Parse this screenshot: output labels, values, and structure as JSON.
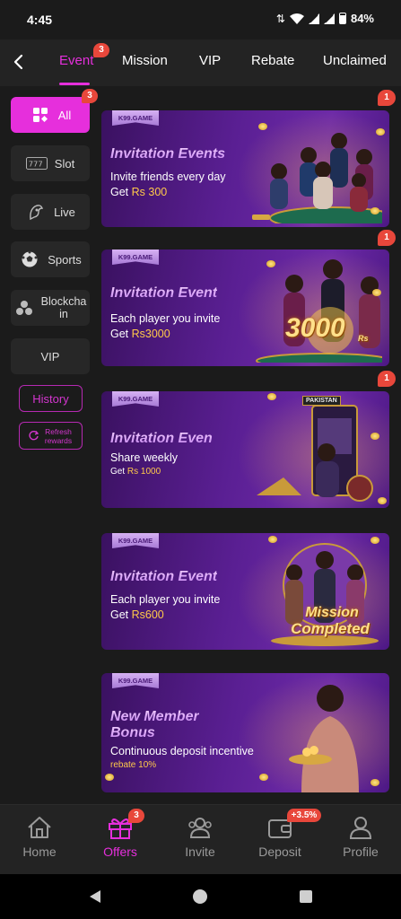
{
  "status": {
    "time": "4:45",
    "battery": "84%"
  },
  "tabs": [
    {
      "label": "Event",
      "badge": "3",
      "active": true
    },
    {
      "label": "Mission"
    },
    {
      "label": "VIP"
    },
    {
      "label": "Rebate"
    },
    {
      "label": "Unclaimed"
    }
  ],
  "sidebar": {
    "items": [
      {
        "label": "All",
        "icon": "grid-icon",
        "badge": "3",
        "active": true
      },
      {
        "label": "Slot",
        "icon": "slot-icon"
      },
      {
        "label": "Live",
        "icon": "live-icon"
      },
      {
        "label": "Sports",
        "icon": "soccer-ball-icon"
      },
      {
        "label": "Blockchain",
        "icon": "blockchain-icon"
      },
      {
        "label": "VIP"
      }
    ],
    "history_label": "History",
    "refresh_label": "Refresh rewards"
  },
  "banners": [
    {
      "brand": "K99.GAME",
      "title": "Invitation Events",
      "subtitle": "Invite friends every day",
      "get_prefix": "Get ",
      "amount": "Rs 300",
      "badge": "1"
    },
    {
      "brand": "K99.GAME",
      "title": "Invitation Event",
      "subtitle": "Each player you invite",
      "get_prefix": "Get ",
      "amount": "Rs3000",
      "badge": "1",
      "art_text": "3000",
      "art_unit": "Rs"
    },
    {
      "brand": "K99.GAME",
      "title": "Invitation Even",
      "subtitle": "Share weekly",
      "get_prefix": "Get ",
      "amount": "Rs 1000",
      "badge": "1",
      "art_text": "PAKISTAN"
    },
    {
      "brand": "K99.GAME",
      "title": "Invitation Event",
      "subtitle": "Each player you invite",
      "get_prefix": "Get ",
      "amount": "Rs600",
      "art_text": "Mission",
      "art_text2": "Completed"
    },
    {
      "brand": "K99.GAME",
      "title": "New Member",
      "title2": "Bonus",
      "subtitle": "Continuous deposit incentive",
      "get_prefix": "",
      "amount": "rebate 10%"
    }
  ],
  "bottom_nav": [
    {
      "label": "Home",
      "icon": "home-icon"
    },
    {
      "label": "Offers",
      "icon": "gift-icon",
      "badge": "3",
      "active": true
    },
    {
      "label": "Invite",
      "icon": "invite-icon"
    },
    {
      "label": "Deposit",
      "icon": "wallet-icon",
      "badge": "+3.5%"
    },
    {
      "label": "Profile",
      "icon": "profile-icon"
    }
  ],
  "colors": {
    "accent": "#e62fdc",
    "badge": "#e8473b",
    "gold": "#ffc94a"
  }
}
